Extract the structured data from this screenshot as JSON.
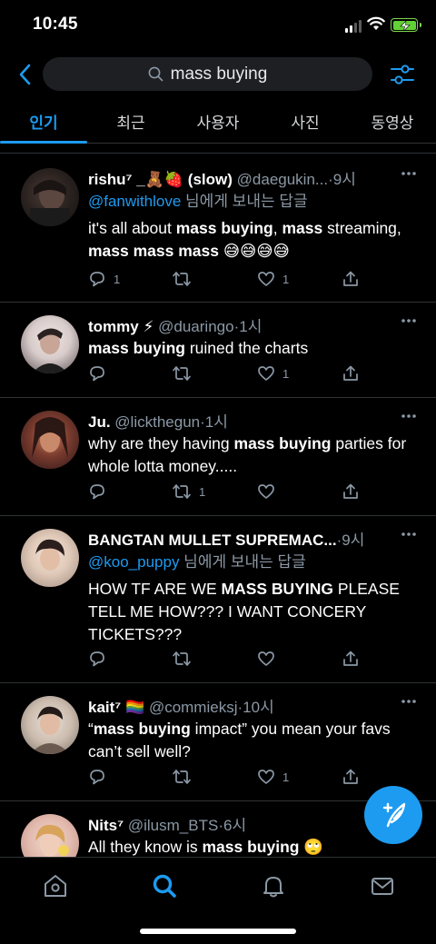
{
  "status_bar": {
    "time": "10:45"
  },
  "search": {
    "query": "mass buying"
  },
  "tabs": [
    {
      "label": "인기",
      "active": true
    },
    {
      "label": "최근"
    },
    {
      "label": "사용자"
    },
    {
      "label": "사진"
    },
    {
      "label": "동영상"
    }
  ],
  "tweets": [
    {
      "name": "rishu⁷ _🧸🍓 (slow)",
      "handle": "@daegukin...",
      "dot": "·",
      "time": "9시",
      "reply_to": "@fanwithlove",
      "reply_suffix": " 님에게 보내는 답글",
      "text_parts": [
        "it's all about ",
        "mass buying",
        ", ",
        "mass",
        " streaming, ",
        "mass mass mass",
        " 😅😅😅😅"
      ],
      "replies": "1",
      "retweets": "",
      "likes": "1"
    },
    {
      "name": "tommy ⚡",
      "handle": "@duaringo",
      "dot": "·",
      "time": "1시",
      "text_parts": [
        "mass buying",
        " ruined the charts"
      ],
      "replies": "",
      "retweets": "",
      "likes": "1"
    },
    {
      "name": "Ju.",
      "handle": "@lickthegun",
      "dot": "·",
      "time": "1시",
      "text_parts": [
        "why are they having ",
        "mass buying",
        " parties for whole lotta money....."
      ],
      "replies": "",
      "retweets": "1",
      "likes": ""
    },
    {
      "name": "BANGTAN MULLET SUPREMAC...",
      "handle": "",
      "dot": "·",
      "time": "9시",
      "reply_to": "@koo_puppy",
      "reply_suffix": " 님에게 보내는 답글",
      "text_parts": [
        "HOW TF ARE WE ",
        "MASS BUYING",
        " PLEASE TELL ME HOW??? I WANT CONCERY TICKETS???"
      ],
      "replies": "",
      "retweets": "",
      "likes": ""
    },
    {
      "name": "kait⁷ 🏳️‍🌈",
      "handle": "@commieksj",
      "dot": "·",
      "time": "10시",
      "text_parts": [
        "“",
        "mass buying",
        " impact” you mean your favs can’t sell well?"
      ],
      "replies": "",
      "retweets": "",
      "likes": "1"
    },
    {
      "name": "Nits⁷",
      "handle": "@ilusm_BTS",
      "dot": "·",
      "time": "6시",
      "text_parts": [
        "All they know is ",
        "mass buying",
        " 🙄"
      ],
      "replies": "",
      "retweets": "",
      "likes": ""
    }
  ],
  "colors": {
    "accent": "#1d9bf0",
    "muted": "#8b98a5",
    "background": "#000000",
    "divider": "#2f3336"
  },
  "icons": [
    "back-arrow-icon",
    "search-icon",
    "filter-icon",
    "more-icon",
    "reply-icon",
    "retweet-icon",
    "heart-icon",
    "share-icon",
    "compose-icon",
    "home-icon",
    "explore-icon",
    "notifications-icon",
    "messages-icon"
  ]
}
